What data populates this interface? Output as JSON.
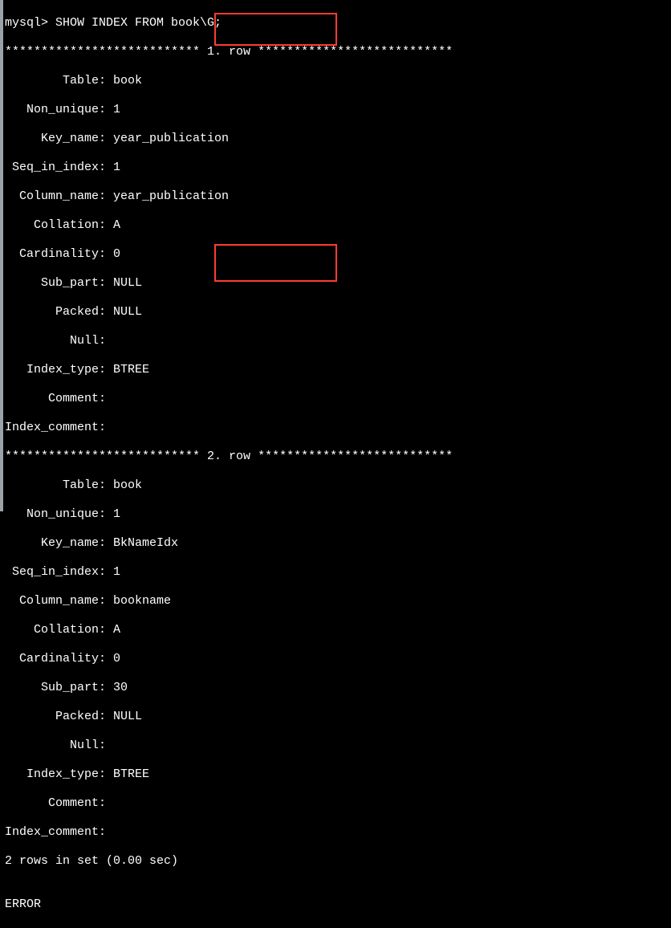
{
  "prompt": "mysql> ",
  "command": "SHOW INDEX FROM book\\G;",
  "separator_prefix": "*************************** ",
  "separator_suffix": " ***************************",
  "row1_label": "1. row",
  "row2_label": "2. row",
  "labels": {
    "Table": "        Table: ",
    "Non_unique": "   Non_unique: ",
    "Key_name": "     Key_name: ",
    "Seq_in_index": " Seq_in_index: ",
    "Column_name": "  Column_name: ",
    "Collation": "    Collation: ",
    "Cardinality": "  Cardinality: ",
    "Sub_part": "     Sub_part: ",
    "Packed": "       Packed: ",
    "Null": "         Null: ",
    "Index_type": "   Index_type: ",
    "Comment": "      Comment: ",
    "Index_comment": "Index_comment: "
  },
  "rows": [
    {
      "Table": "book",
      "Non_unique": "1",
      "Key_name": "year_publication",
      "Seq_in_index": "1",
      "Column_name": "year_publication",
      "Collation": "A",
      "Cardinality": "0",
      "Sub_part": "NULL",
      "Packed": "NULL",
      "Null": "",
      "Index_type": "BTREE",
      "Comment": "",
      "Index_comment": ""
    },
    {
      "Table": "book",
      "Non_unique": "1",
      "Key_name": "BkNameIdx",
      "Seq_in_index": "1",
      "Column_name": "bookname",
      "Collation": "A",
      "Cardinality": "0",
      "Sub_part": "30",
      "Packed": "NULL",
      "Null": "",
      "Index_type": "BTREE",
      "Comment": "",
      "Index_comment": ""
    }
  ],
  "footer": "2 rows in set (0.00 sec)",
  "blank": "",
  "error_partial": "ERROR"
}
